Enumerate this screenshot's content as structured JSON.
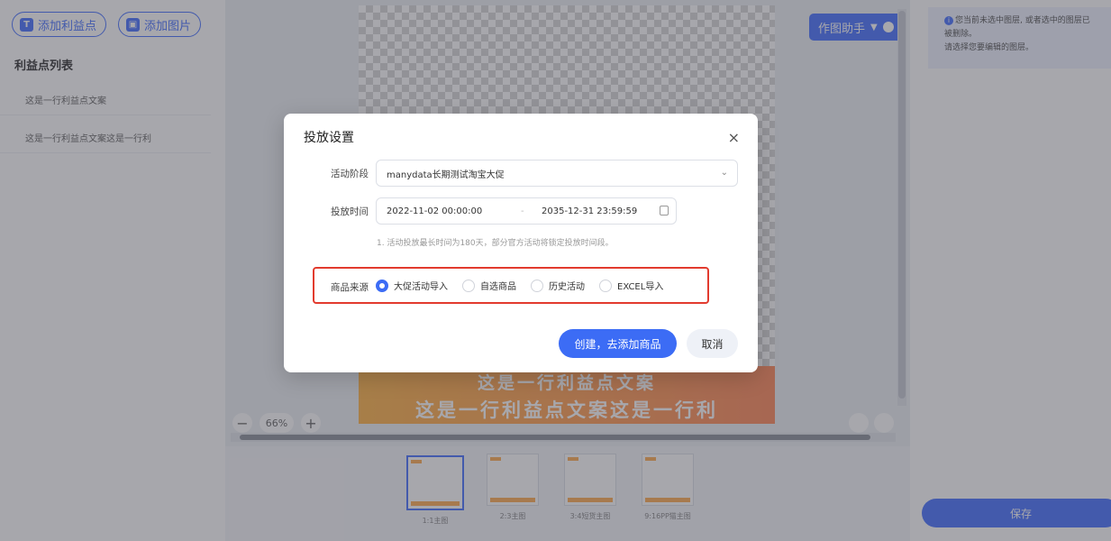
{
  "left_panel": {
    "add_benefit_label": "添加利益点",
    "add_image_label": "添加图片",
    "list_title": "利益点列表",
    "items": [
      {
        "label": "这是一行利益点文案"
      },
      {
        "label": "这是一行利益点文案这是一行利"
      }
    ]
  },
  "canvas": {
    "helper_label": "作图助手",
    "banner_line1": "这是一行利益点文案",
    "banner_line2": "这是一行利益点文案这是一行利",
    "zoom_value": "66%",
    "zoom_minus": "−",
    "zoom_plus": "+"
  },
  "thumbnails": [
    {
      "caption": "1:1主图"
    },
    {
      "caption": "2:3主图"
    },
    {
      "caption": "3:4短货主图"
    },
    {
      "caption": "9:16PP猫主图"
    }
  ],
  "right_panel": {
    "tip_line1": "您当前未选中图层, 或者选中的图层已",
    "tip_line2": "被删除。",
    "tip_line3": "请选择您要编辑的图层。",
    "save_label": "保存"
  },
  "modal": {
    "title": "投放设置",
    "close": "×",
    "stage_label": "活动阶段",
    "stage_value": "manydata长期测试淘宝大促",
    "time_label": "投放时间",
    "start_time": "2022-11-02 00:00:00",
    "time_sep": "-",
    "end_time": "2035-12-31 23:59:59",
    "hint": "1. 活动投放最长时间为180天，部分官方活动将锁定投放时间段。",
    "source_label": "商品来源",
    "source_options": [
      {
        "label": "大促活动导入",
        "selected": true
      },
      {
        "label": "自选商品",
        "selected": false
      },
      {
        "label": "历史活动",
        "selected": false
      },
      {
        "label": "EXCEL导入",
        "selected": false
      }
    ],
    "create_label": "创建，去添加商品",
    "cancel_label": "取消"
  },
  "colors": {
    "accent": "#3c6cf5",
    "highlight_border": "#e23b2e",
    "banner": "#ff9a4f"
  }
}
